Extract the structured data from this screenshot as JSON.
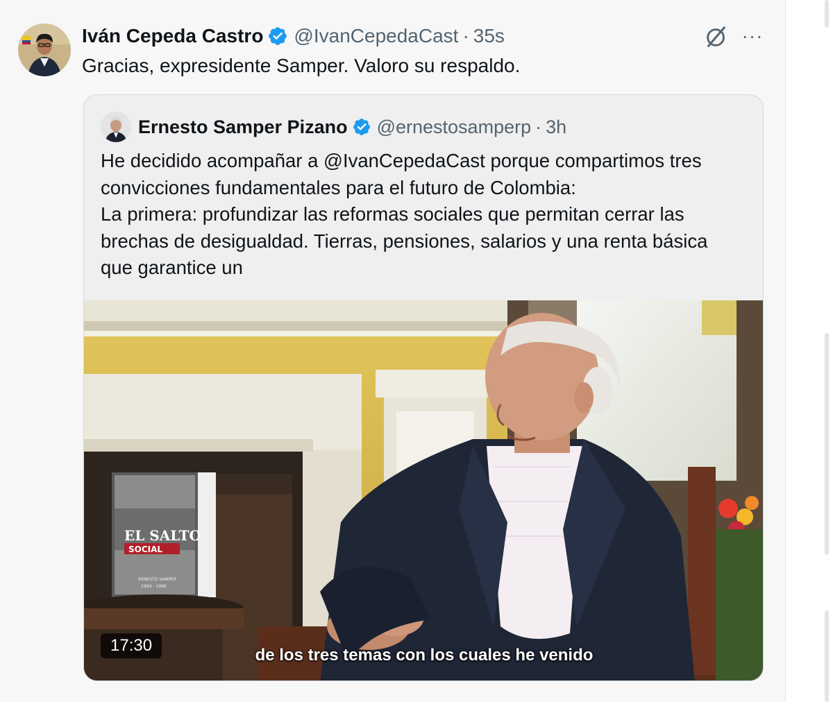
{
  "tweet": {
    "author_name": "Iván Cepeda Castro",
    "handle": "@IvanCepedaCast",
    "separator": "·",
    "time": "35s",
    "text": "Gracias, expresidente Samper. Valoro su respaldo.",
    "more_label": "···",
    "icons": {
      "grok": "grok-slash-icon",
      "verified": "verified-badge-icon",
      "more": "more-icon"
    },
    "colors": {
      "verified": "#1d9bf0",
      "secondary_text": "#536471",
      "border": "#cfd9de"
    }
  },
  "quote": {
    "author_name": "Ernesto Samper Pizano",
    "handle": "@ernestosamperp",
    "separator": "·",
    "time": "3h",
    "text_lines": [
      "He decidido acompañar a @IvanCepedaCast porque compartimos tres",
      "convicciones fundamentales para el futuro de Colombia:",
      "La primera: profundizar las reformas sociales que permitan cerrar las",
      "brechas de desigualdad. Tierras, pensiones, salarios y una renta básica",
      "que garantice un"
    ],
    "media": {
      "kind": "video",
      "duration": "17:30",
      "caption": "de los tres temas con los cuales he venido",
      "book_title": "EL SALTO",
      "book_subtitle": "SOCIAL",
      "book_author": "ERNESTO SAMPER",
      "book_years": "1994 - 1998"
    }
  }
}
